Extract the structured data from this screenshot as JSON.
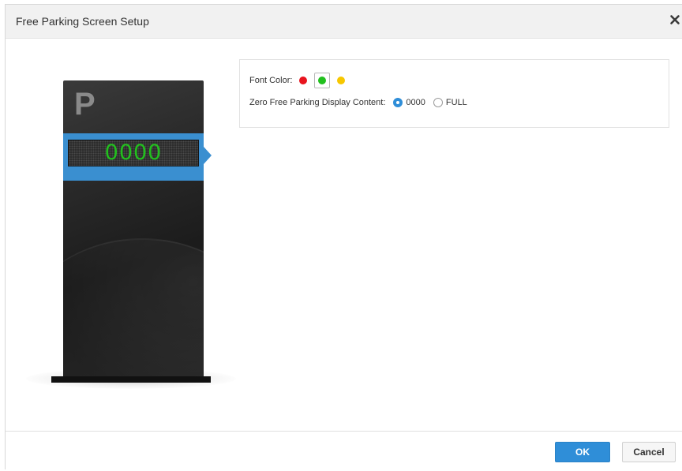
{
  "dialog": {
    "title": "Free Parking Screen Setup"
  },
  "sign": {
    "logo_letter": "P",
    "display_text": "0000",
    "display_color": "#22c01e",
    "band_color": "#3a8fd0"
  },
  "settings": {
    "font_color_label": "Font Color:",
    "font_colors": [
      {
        "name": "red",
        "hex": "#e8141e",
        "selected": false
      },
      {
        "name": "green",
        "hex": "#22c01e",
        "selected": true
      },
      {
        "name": "yellow",
        "hex": "#f7c700",
        "selected": false
      }
    ],
    "zero_label": "Zero Free Parking Display Content:",
    "zero_options": [
      {
        "label": "0000",
        "checked": true
      },
      {
        "label": "FULL",
        "checked": false
      }
    ]
  },
  "footer": {
    "ok_label": "OK",
    "cancel_label": "Cancel"
  },
  "colors": {
    "accent": "#2f8ed8"
  }
}
